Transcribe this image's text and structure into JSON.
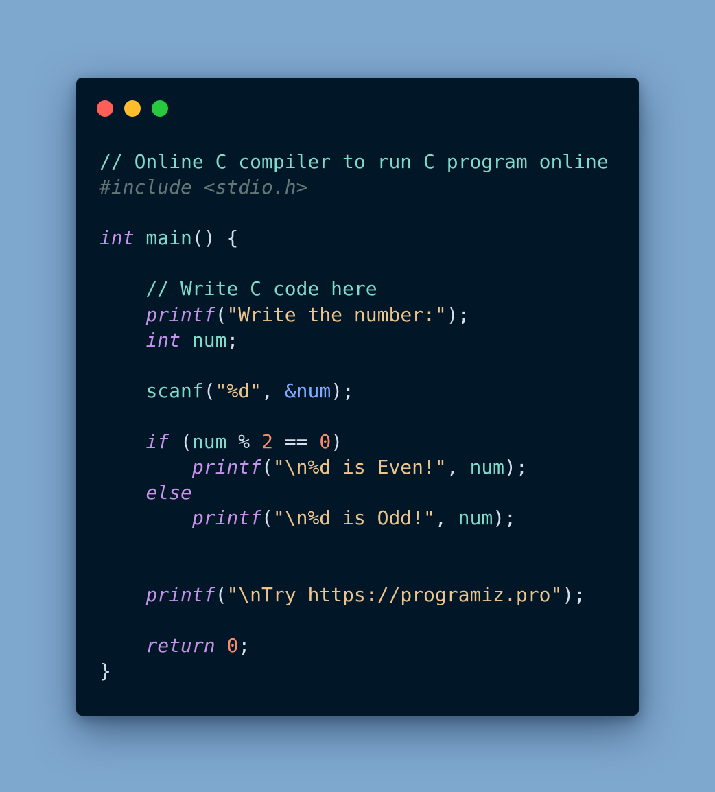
{
  "window": {
    "controls": [
      {
        "name": "close",
        "color": "#ff5f56"
      },
      {
        "name": "minimize",
        "color": "#ffbd2e"
      },
      {
        "name": "maximize",
        "color": "#27c93f"
      }
    ]
  },
  "code": {
    "language": "C",
    "lines": [
      [
        {
          "t": "// Online C compiler to run C program online",
          "k": "comment"
        }
      ],
      [
        {
          "t": "#include <stdio.h>",
          "k": "preproc"
        }
      ],
      [],
      [
        {
          "t": "int",
          "k": "keyword"
        },
        {
          "t": " main",
          "k": "ident"
        },
        {
          "t": "() {",
          "k": "punct"
        }
      ],
      [],
      [
        {
          "t": "    // Write C code here",
          "k": "comment"
        }
      ],
      [
        {
          "t": "    ",
          "k": "punct"
        },
        {
          "t": "printf",
          "k": "func"
        },
        {
          "t": "(",
          "k": "punct"
        },
        {
          "t": "\"Write the number:\"",
          "k": "string"
        },
        {
          "t": ");",
          "k": "punct"
        }
      ],
      [
        {
          "t": "    ",
          "k": "punct"
        },
        {
          "t": "int",
          "k": "keyword"
        },
        {
          "t": " num",
          "k": "ident"
        },
        {
          "t": ";",
          "k": "punct"
        }
      ],
      [],
      [
        {
          "t": "    ",
          "k": "punct"
        },
        {
          "t": "scanf",
          "k": "ident"
        },
        {
          "t": "(",
          "k": "punct"
        },
        {
          "t": "\"%d\"",
          "k": "string"
        },
        {
          "t": ", ",
          "k": "punct"
        },
        {
          "t": "&num",
          "k": "ref"
        },
        {
          "t": ");",
          "k": "punct"
        }
      ],
      [],
      [
        {
          "t": "    ",
          "k": "punct"
        },
        {
          "t": "if",
          "k": "keyword"
        },
        {
          "t": " (",
          "k": "punct"
        },
        {
          "t": "num",
          "k": "ident"
        },
        {
          "t": " % ",
          "k": "punct"
        },
        {
          "t": "2",
          "k": "number"
        },
        {
          "t": " == ",
          "k": "punct"
        },
        {
          "t": "0",
          "k": "number"
        },
        {
          "t": ")",
          "k": "punct"
        }
      ],
      [
        {
          "t": "        ",
          "k": "punct"
        },
        {
          "t": "printf",
          "k": "func"
        },
        {
          "t": "(",
          "k": "punct"
        },
        {
          "t": "\"\\n%d is Even!\"",
          "k": "string"
        },
        {
          "t": ", ",
          "k": "punct"
        },
        {
          "t": "num",
          "k": "ident"
        },
        {
          "t": ");",
          "k": "punct"
        }
      ],
      [
        {
          "t": "    ",
          "k": "punct"
        },
        {
          "t": "else",
          "k": "keyword"
        }
      ],
      [
        {
          "t": "        ",
          "k": "punct"
        },
        {
          "t": "printf",
          "k": "func"
        },
        {
          "t": "(",
          "k": "punct"
        },
        {
          "t": "\"\\n%d is Odd!\"",
          "k": "string"
        },
        {
          "t": ", ",
          "k": "punct"
        },
        {
          "t": "num",
          "k": "ident"
        },
        {
          "t": ");",
          "k": "punct"
        }
      ],
      [],
      [],
      [
        {
          "t": "    ",
          "k": "punct"
        },
        {
          "t": "printf",
          "k": "func"
        },
        {
          "t": "(",
          "k": "punct"
        },
        {
          "t": "\"\\nTry https://programiz.pro\"",
          "k": "string"
        },
        {
          "t": ");",
          "k": "punct"
        }
      ],
      [],
      [
        {
          "t": "    ",
          "k": "punct"
        },
        {
          "t": "return",
          "k": "keyword"
        },
        {
          "t": " ",
          "k": "punct"
        },
        {
          "t": "0",
          "k": "number"
        },
        {
          "t": ";",
          "k": "punct"
        }
      ],
      [
        {
          "t": "}",
          "k": "punct"
        }
      ]
    ]
  }
}
